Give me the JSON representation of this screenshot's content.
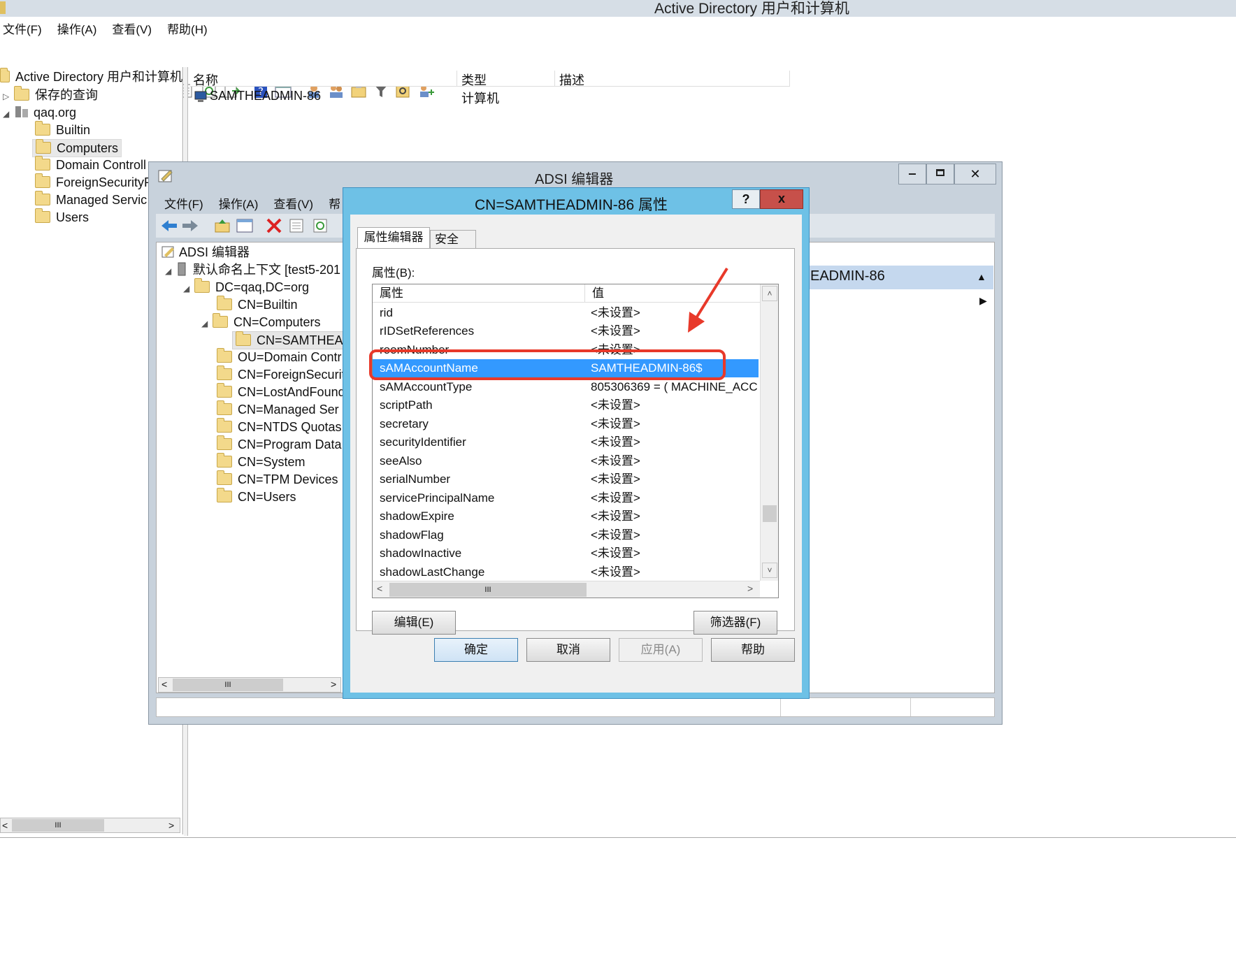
{
  "main": {
    "title": "Active Directory 用户和计算机",
    "menu": [
      "文件(F)",
      "操作(A)",
      "查看(V)",
      "帮助(H)"
    ],
    "tree": {
      "root": "Active Directory 用户和计算机",
      "saved_queries": "保存的查询",
      "domain": "qaq.org",
      "children": [
        "Builtin",
        "Computers",
        "Domain Controll",
        "ForeignSecurityP",
        "Managed Servic",
        "Users"
      ]
    },
    "columns": [
      "名称",
      "类型",
      "描述"
    ],
    "rows": [
      {
        "name": "SAMTHEADMIN-86",
        "type": "计算机",
        "desc": ""
      }
    ]
  },
  "adsi": {
    "title": "ADSI 编辑器",
    "menu": [
      "文件(F)",
      "操作(A)",
      "查看(V)",
      "帮"
    ],
    "tree": {
      "root": "ADSI 编辑器",
      "context": "默认命名上下文 [test5-201",
      "dc": "DC=qaq,DC=org",
      "items": [
        "CN=Builtin",
        "CN=Computers",
        "CN=SAMTHEAD",
        "OU=Domain Contr",
        "CN=ForeignSecurit",
        "CN=LostAndFound",
        "CN=Managed Ser",
        "CN=NTDS Quotas",
        "CN=Program Data",
        "CN=System",
        "CN=TPM Devices",
        "CN=Users"
      ]
    },
    "right_header": "EADMIN-86"
  },
  "dialog": {
    "title": "CN=SAMTHEADMIN-86 属性",
    "help_btn": "?",
    "close_btn": "x",
    "tabs": [
      "属性编辑器",
      "安全"
    ],
    "attributes_label": "属性(B):",
    "col_attr": "属性",
    "col_value": "值",
    "rows": [
      {
        "name": "rid",
        "value": "<未设置>"
      },
      {
        "name": "rIDSetReferences",
        "value": "<未设置>"
      },
      {
        "name": "roomNumber",
        "value": "<未设置>"
      },
      {
        "name": "sAMAccountName",
        "value": "SAMTHEADMIN-86$"
      },
      {
        "name": "sAMAccountType",
        "value": "805306369 = ( MACHINE_ACC"
      },
      {
        "name": "scriptPath",
        "value": "<未设置>"
      },
      {
        "name": "secretary",
        "value": "<未设置>"
      },
      {
        "name": "securityIdentifier",
        "value": "<未设置>"
      },
      {
        "name": "seeAlso",
        "value": "<未设置>"
      },
      {
        "name": "serialNumber",
        "value": "<未设置>"
      },
      {
        "name": "servicePrincipalName",
        "value": "<未设置>"
      },
      {
        "name": "shadowExpire",
        "value": "<未设置>"
      },
      {
        "name": "shadowFlag",
        "value": "<未设置>"
      },
      {
        "name": "shadowInactive",
        "value": "<未设置>"
      },
      {
        "name": "shadowLastChange",
        "value": "<未设置>"
      }
    ],
    "edit_btn": "编辑(E)",
    "filter_btn": "筛选器(F)",
    "ok_btn": "确定",
    "cancel_btn": "取消",
    "apply_btn": "应用(A)",
    "help2_btn": "帮助",
    "selected_color": "#3399ff",
    "annotation_color": "#e8392a"
  }
}
